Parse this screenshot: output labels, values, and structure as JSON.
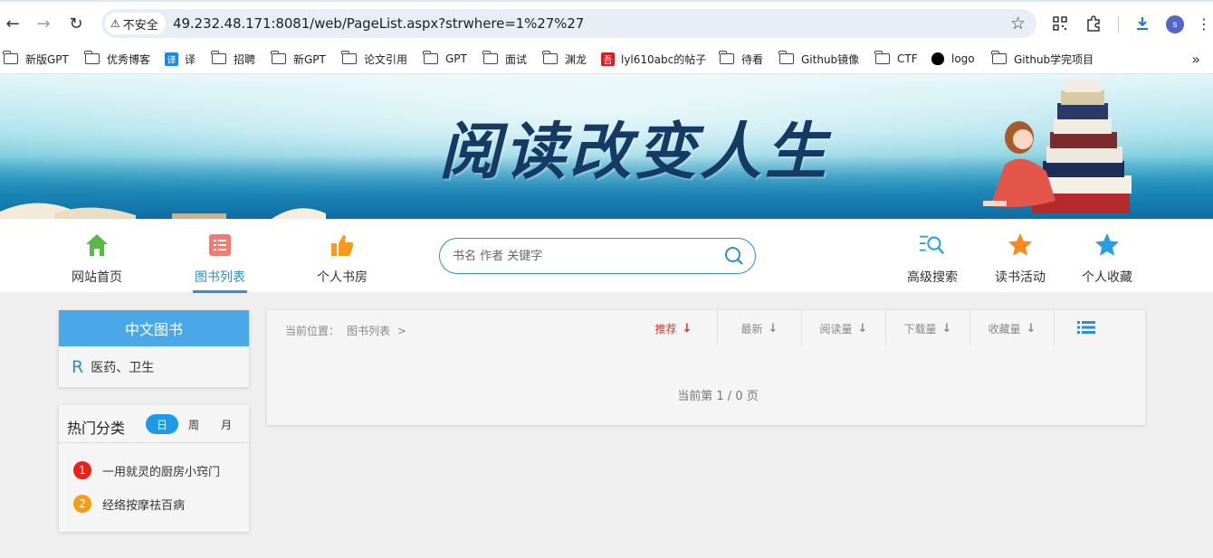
{
  "browser": {
    "security_label": "不安全",
    "url": "49.232.48.171:8081/web/PageList.aspx?strwhere=1%27%27",
    "profile_initial": "s",
    "bookmarks": [
      "新版GPT",
      "优秀博客",
      "译",
      "招聘",
      "新GPT",
      "论文引用",
      "GPT",
      "面试",
      "渊龙",
      "lyl610abc的帖子",
      "待看",
      "Github镜像",
      "CTF",
      "logo",
      "Github学完项目"
    ]
  },
  "banner": {
    "title": "阅读改变人生"
  },
  "nav": {
    "items": [
      {
        "label": "网站首页",
        "color": "#5bb847"
      },
      {
        "label": "图书列表",
        "color": "#f47a73"
      },
      {
        "label": "个人书房",
        "color": "#f79a1e"
      },
      {
        "label": "高级搜索",
        "color": "#2a9ee3"
      },
      {
        "label": "读书活动",
        "color": "#f58b1e"
      },
      {
        "label": "个人收藏",
        "color": "#2a9ee3"
      }
    ],
    "active": "图书列表",
    "search_placeholder": "书名 作者 关键字"
  },
  "sidebar": {
    "category_title": "中文图书",
    "categories": [
      {
        "code": "R",
        "name": "医药、卫生"
      }
    ],
    "hot_title": "热门分类",
    "tabs": [
      "日",
      "周",
      "月"
    ],
    "active_tab": "日",
    "hot_items": [
      {
        "rank": "1",
        "text": "一用就灵的厨房小窍门",
        "color": "#e8221b"
      },
      {
        "rank": "2",
        "text": "经络按摩祛百病",
        "color": "#f5a012"
      }
    ]
  },
  "main": {
    "breadcrumb_label": "当前位置：",
    "breadcrumb_page": "图书列表",
    "breadcrumb_sep": ">",
    "sorts": [
      "推荐",
      "最新",
      "阅读量",
      "下载量",
      "收藏量"
    ],
    "active_sort": "推荐",
    "pager_text": "当前第 1 / 0 页"
  },
  "colors": {
    "accent": "#2a8fd6",
    "sort_active": "#e0302b",
    "category_header": "#4aa8e8"
  }
}
